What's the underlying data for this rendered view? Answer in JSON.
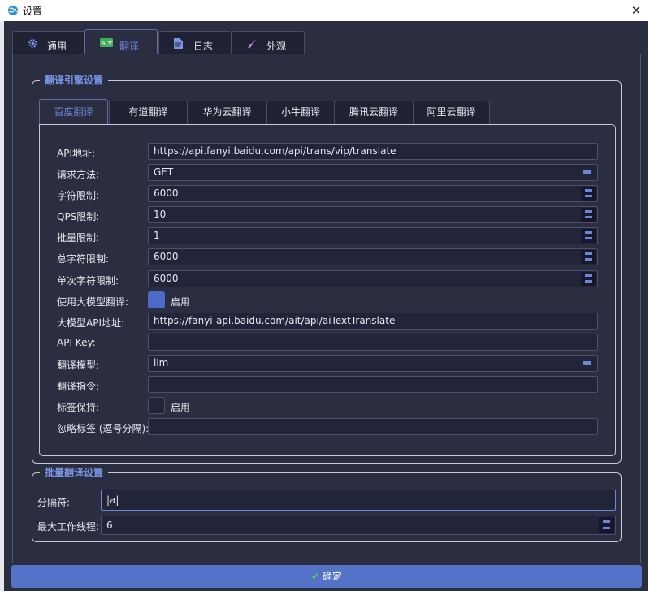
{
  "titlebar": {
    "title": "设置",
    "close": "✕"
  },
  "tabs": [
    {
      "label": "通用",
      "icon": "gear-icon"
    },
    {
      "label": "翻译",
      "icon": "translate-icon"
    },
    {
      "label": "日志",
      "icon": "document-icon"
    },
    {
      "label": "外观",
      "icon": "brush-icon"
    }
  ],
  "engine_group": {
    "title": "翻译引擎设置",
    "subtabs": [
      "百度翻译",
      "有道翻译",
      "华为云翻译",
      "小牛翻译",
      "腾讯云翻译",
      "阿里云翻译"
    ],
    "fields": {
      "api_url": {
        "label": "API地址:",
        "value": "https://api.fanyi.baidu.com/api/trans/vip/translate"
      },
      "method": {
        "label": "请求方法:",
        "value": "GET"
      },
      "char_limit": {
        "label": "字符限制:",
        "value": "6000"
      },
      "qps_limit": {
        "label": "QPS限制:",
        "value": "10"
      },
      "batch_limit": {
        "label": "批量限制:",
        "value": "1"
      },
      "total_char_limit": {
        "label": "总字符限制:",
        "value": "6000"
      },
      "single_char_limit": {
        "label": "单次字符限制:",
        "value": "6000"
      },
      "use_llm": {
        "label": "使用大模型翻译:",
        "check_label": "启用",
        "checked": true
      },
      "llm_api_url": {
        "label": "大模型API地址:",
        "value": "https://fanyi-api.baidu.com/ait/api/aiTextTranslate"
      },
      "api_key": {
        "label": "API Key:",
        "value": ""
      },
      "model": {
        "label": "翻译模型:",
        "value": "llm"
      },
      "instruction": {
        "label": "翻译指令:",
        "value": ""
      },
      "tag_keep": {
        "label": "标签保持:",
        "check_label": "启用",
        "checked": false
      },
      "ignore_tags": {
        "label": "忽略标签 (逗号分隔):",
        "value": ""
      }
    }
  },
  "batch_group": {
    "title": "批量翻译设置",
    "separator": {
      "label": "分隔符:",
      "value": "|a|"
    },
    "max_workers": {
      "label": "最大工作线程:",
      "value": "6"
    }
  },
  "ok_button": {
    "label": "确定"
  },
  "colors": {
    "background": "#2b2d40",
    "accent": "#6e86d8",
    "button": "#5472c6",
    "check": "#4fd06a"
  }
}
